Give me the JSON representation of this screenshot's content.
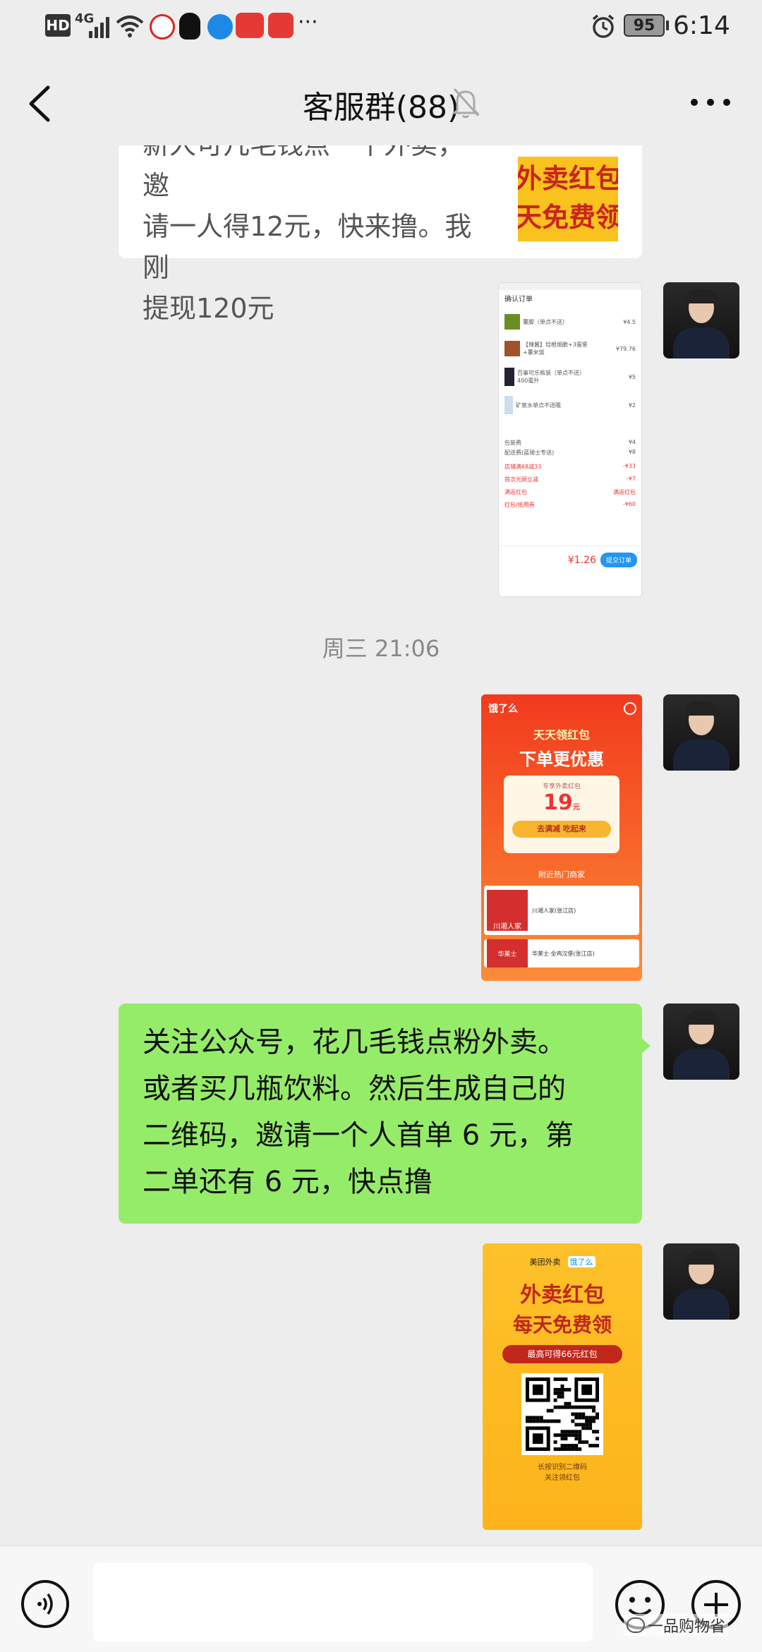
{
  "status_bar": {
    "hd": "HD",
    "network": "4G",
    "more": "···",
    "battery": "95",
    "time": "6:14"
  },
  "header": {
    "title": "客服群(88)"
  },
  "messages": {
    "partial_text_lines": [
      "新人可几毛钱点一个外卖，邀",
      "请一人得12元，快来撸。我刚",
      "提现120元"
    ],
    "partial_image": {
      "line1": "外卖红包",
      "line2": "天免费领"
    },
    "order_screenshot": {
      "title": "确认订单",
      "items": [
        {
          "name": "薯脚（单点不送）",
          "price": "¥4.5"
        },
        {
          "name": "【辣酱】培根焗脆+3蛋堡+薯米饭",
          "price": "¥79.76"
        },
        {
          "name": "百事可乐瓶装（单点不送）400毫升",
          "price": "¥5"
        },
        {
          "name": "矿泉水单点不送哦",
          "price": "¥2"
        }
      ],
      "fees": [
        {
          "name": "包装费",
          "value": "¥4"
        },
        {
          "name": "配送费(蓝骑士专送)",
          "value": "¥8"
        }
      ],
      "discounts": [
        {
          "name": "店铺满68减33",
          "value": "-¥33"
        },
        {
          "name": "首次光顾立减",
          "value": "-¥7"
        },
        {
          "name": "满返红包",
          "value": "满返红包"
        },
        {
          "name": "红包/抵用券",
          "value": "-¥60"
        }
      ],
      "total": "¥1.26",
      "submit": "提交订单"
    },
    "timestamp": "周三 21:06",
    "eleme_poster": {
      "brand": "饿了么",
      "banner_top": "天天领红包",
      "banner_main": "下单更优惠",
      "coupon_label": "专享外卖红包",
      "coupon_amount": "19",
      "coupon_unit": "元",
      "cta": "去满减 吃起来",
      "section": "附近热门商家",
      "shops": [
        {
          "logo": "川湘人家",
          "name": "川湘人家(张江店)"
        },
        {
          "logo": "华莱士",
          "name": "华莱士·全鸡汉堡(张江店)"
        }
      ]
    },
    "green_text_lines": [
      "关注公众号，花几毛钱点粉外卖。",
      "或者买几瓶饮料。然后生成自己的",
      "二维码，邀请一个人首单 6 元，第",
      "二单还有 6 元，快点撸"
    ],
    "qr_poster": {
      "logo1": "美团外卖",
      "logo2": "饿了么",
      "line1": "外卖红包",
      "line2": "每天免费领",
      "badge": "最高可得66元红包",
      "caption1": "长按识别二维码",
      "caption2": "关注领红包"
    }
  },
  "watermark": "一品购物省",
  "colors": {
    "bg": "#ededed",
    "green_bubble": "#95ec69",
    "white_bubble": "#ffffff",
    "eleme_blue": "#0097ff",
    "eleme_red": "#f23a1e",
    "qr_yellow": "#fdc12a"
  }
}
